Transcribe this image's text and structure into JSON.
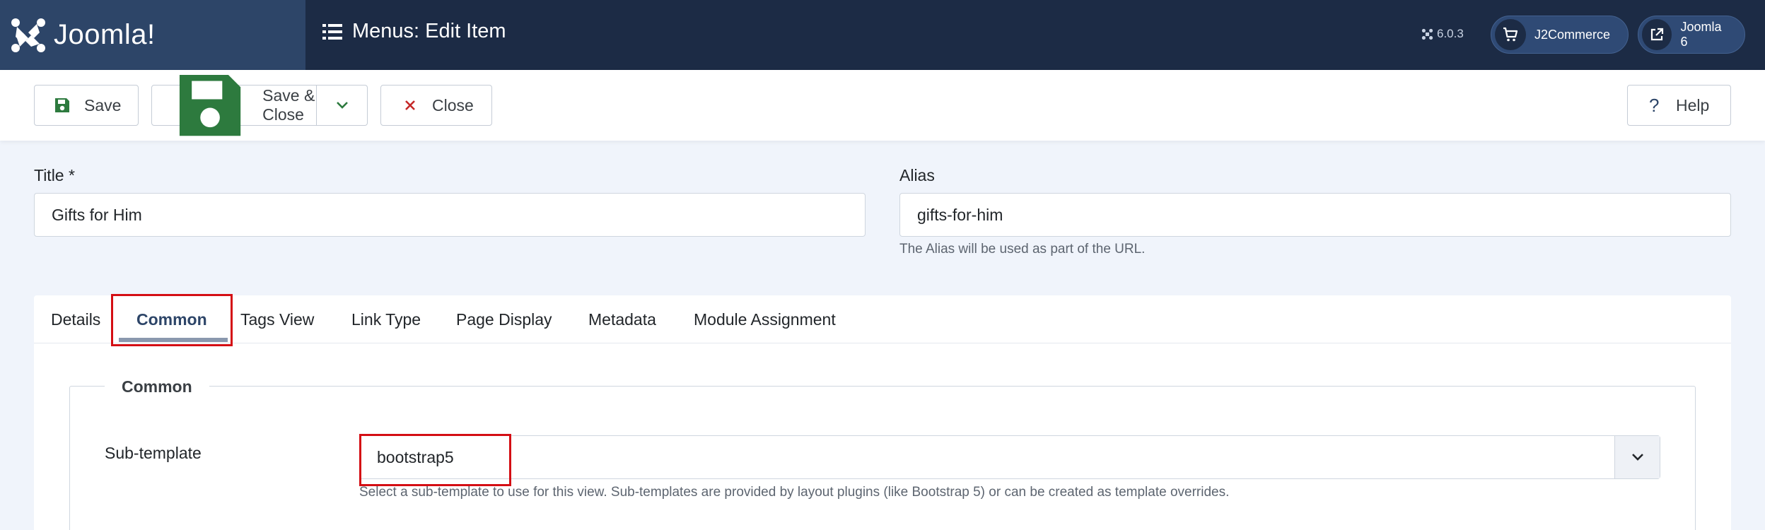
{
  "header": {
    "brand_name": "Joomla!",
    "page_title": "Menus: Edit Item",
    "version": "6.0.3",
    "user_pills": [
      {
        "label": "J2Commerce",
        "icon": "cart-icon"
      },
      {
        "label": "Joomla 6",
        "icon": "external-link-icon"
      }
    ]
  },
  "toolbar": {
    "save_label": "Save",
    "save_close_label": "Save & Close",
    "close_label": "Close",
    "help_label": "Help"
  },
  "form": {
    "title_label": "Title *",
    "title_value": "Gifts for Him",
    "alias_label": "Alias",
    "alias_value": "gifts-for-him",
    "alias_help": "The Alias will be used as part of the URL."
  },
  "tabs": [
    {
      "label": "Details"
    },
    {
      "label": "Common",
      "active": true
    },
    {
      "label": "Tags View"
    },
    {
      "label": "Link Type"
    },
    {
      "label": "Page Display"
    },
    {
      "label": "Metadata"
    },
    {
      "label": "Module Assignment"
    }
  ],
  "common": {
    "legend": "Common",
    "subtemplate_label": "Sub-template",
    "subtemplate_value": "bootstrap5",
    "subtemplate_help": "Select a sub-template to use for this view. Sub-templates are provided by layout plugins (like Bootstrap 5) or can be created as template overrides."
  },
  "colors": {
    "header_bg": "#1c2b45",
    "brand_bg": "#2d4568",
    "highlight": "#d40e14",
    "save_icon": "#2d7a3e",
    "close_icon": "#c52828"
  }
}
